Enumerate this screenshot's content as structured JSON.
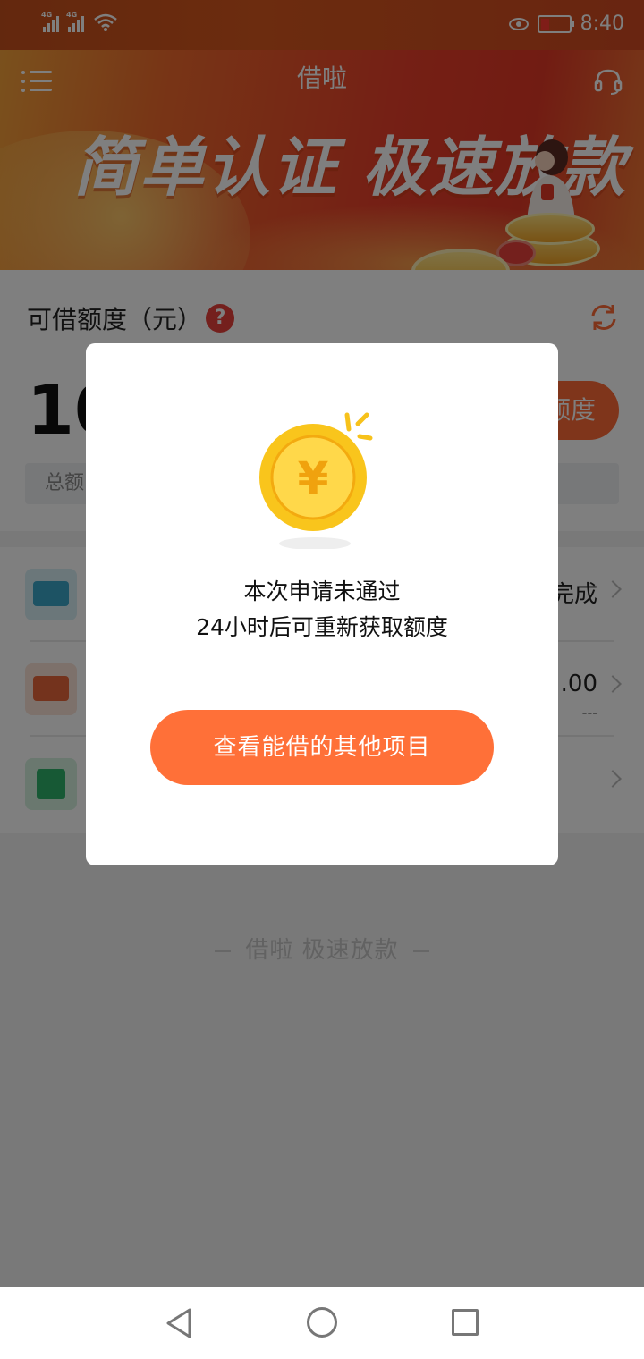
{
  "status_bar": {
    "signal1_label": "4G",
    "signal2_label": "4G",
    "time": "8:40"
  },
  "header": {
    "app_title": "借啦",
    "slogan": "简单认证 极速放款"
  },
  "quota": {
    "label": "可借额度（元）",
    "amount_partial": "10",
    "get_quota_button_partial": "额度",
    "total_partial": "总额"
  },
  "rows": [
    {
      "icon": "id-card-icon",
      "right_text": "完成",
      "sub_text": ""
    },
    {
      "icon": "bank-card-icon",
      "right_text": ".00",
      "sub_text": "---"
    },
    {
      "icon": "clipboard-icon",
      "right_text": "",
      "sub_text": ""
    }
  ],
  "footer_slogan": "借啦  极速放款",
  "dialog": {
    "line1": "本次申请未通过",
    "line2": "24小时后可重新获取额度",
    "button_label": "查看能借的其他项目"
  },
  "colors": {
    "accent": "#ff7038",
    "help_red": "#e8403a",
    "coin_gold": "#f7c21b"
  }
}
